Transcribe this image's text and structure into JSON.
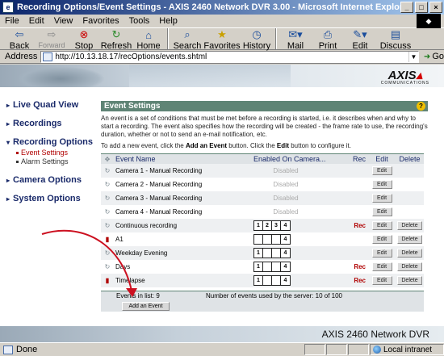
{
  "window": {
    "title": "Recording Options/Event Settings - AXIS 2460 Network DVR 3.00 - Microsoft Internet Explorer",
    "minimize": "_",
    "maximize": "□",
    "close": "×"
  },
  "menu": [
    "File",
    "Edit",
    "View",
    "Favorites",
    "Tools",
    "Help"
  ],
  "toolbar": {
    "back": "Back",
    "forward": "Forward",
    "stop": "Stop",
    "refresh": "Refresh",
    "home": "Home",
    "search": "Search",
    "favorites": "Favorites",
    "history": "History",
    "mail": "Mail",
    "print": "Print",
    "edit": "Edit",
    "discuss": "Discuss"
  },
  "address": {
    "label": "Address",
    "url": "http://10.13.18.17/recOptions/events.shtml",
    "go": "Go"
  },
  "logo": {
    "word": "AXIS",
    "sub": "COMMUNICATIONS"
  },
  "nav": {
    "live_quad": "Live Quad View",
    "recordings": "Recordings",
    "recording_options": "Recording Options",
    "event_settings": "Event Settings",
    "alarm_settings": "Alarm Settings",
    "camera_options": "Camera Options",
    "system_options": "System Options"
  },
  "panel": {
    "title": "Event Settings",
    "help": "?",
    "intro": "An event is a set of conditions that must be met before a recording is started, i.e. it describes when and why to start a recording. The event also specifies how the recording will be created - the frame rate to use, the recording's duration, whether or not to send an e-mail notification, etc.",
    "add_pre": "To add a new event, click the ",
    "add_bold": "Add an Event",
    "add_mid": " button. Click the ",
    "edit_bold": "Edit",
    "add_post": " button to configure it."
  },
  "table": {
    "headers": {
      "name": "Event Name",
      "enabled": "Enabled On Camera...",
      "rec": "Rec",
      "edit": "Edit",
      "delete": "Delete"
    },
    "rows": [
      {
        "name": "Camera 1 - Manual Recording",
        "status": "Disabled",
        "cams": null,
        "rec": "",
        "edit": "Edit",
        "delete": "",
        "icon": "ptz"
      },
      {
        "name": "Camera 2 - Manual Recording",
        "status": "Disabled",
        "cams": null,
        "rec": "",
        "edit": "Edit",
        "delete": "",
        "icon": "ptz"
      },
      {
        "name": "Camera 3 - Manual Recording",
        "status": "Disabled",
        "cams": null,
        "rec": "",
        "edit": "Edit",
        "delete": "",
        "icon": "ptz"
      },
      {
        "name": "Camera 4 - Manual Recording",
        "status": "Disabled",
        "cams": null,
        "rec": "",
        "edit": "Edit",
        "delete": "",
        "icon": "ptz"
      },
      {
        "name": "Continuous recording",
        "status": "",
        "cams": [
          "1",
          "2",
          "3",
          "4"
        ],
        "rec": "Rec",
        "edit": "Edit",
        "delete": "Delete",
        "icon": "ptz"
      },
      {
        "name": "A1",
        "status": "",
        "cams": [
          "",
          "",
          "",
          "4"
        ],
        "rec": "",
        "edit": "Edit",
        "delete": "Delete",
        "icon": "alarm"
      },
      {
        "name": "Weekday Evening",
        "status": "",
        "cams": [
          "1",
          "",
          "",
          "4"
        ],
        "rec": "",
        "edit": "Edit",
        "delete": "Delete",
        "icon": "ptz"
      },
      {
        "name": "Days",
        "status": "",
        "cams": [
          "1",
          "",
          "",
          "4"
        ],
        "rec": "Rec",
        "edit": "Edit",
        "delete": "Delete",
        "icon": "ptz"
      },
      {
        "name": "Timelapse",
        "status": "",
        "cams": [
          "1",
          "",
          "",
          "4"
        ],
        "rec": "Rec",
        "edit": "Edit",
        "delete": "Delete",
        "icon": "alarm"
      }
    ],
    "events_in_list": "Events in list: 9",
    "events_used": "Number of events used by the server: 10 of 100",
    "add_button": "Add an Event"
  },
  "brand": "AXIS 2460 Network DVR",
  "status": {
    "text": "Done",
    "zone": "Local intranet"
  },
  "colors": {
    "panel_header": "#5f8475",
    "rec_red": "#b00000",
    "annotation_arrow": "#cc1020"
  }
}
